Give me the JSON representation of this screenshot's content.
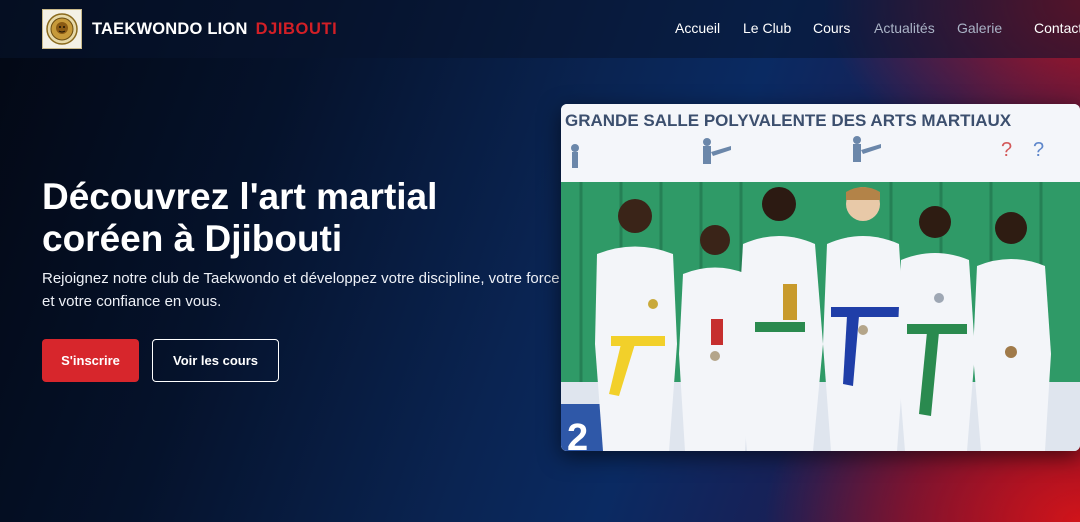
{
  "brand": {
    "name": "TAEKWONDO LION",
    "accent": "DJIBOUTI",
    "logo_icon": "lion-emblem-icon"
  },
  "nav": {
    "items": [
      {
        "label": "Accueil",
        "state": "active"
      },
      {
        "label": "Le Club",
        "state": "active"
      },
      {
        "label": "Cours",
        "state": "active"
      },
      {
        "label": "Actualités",
        "state": "dim"
      },
      {
        "label": "Galerie",
        "state": "dim"
      },
      {
        "label": "Contact",
        "state": "active"
      }
    ]
  },
  "hero": {
    "title_line1": "Découvrez l'art martial",
    "title_line2": "coréen à Djibouti",
    "subtitle_line1": "Rejoignez notre club de Taekwondo et développez votre discipline, votre force",
    "subtitle_line2": "et votre confiance en vous.",
    "primary_button": "S'inscrire",
    "secondary_button": "Voir les cours"
  },
  "photo": {
    "banner_text": "GRANDE SALLE POLYVALENTE DES ARTS MARTIAUX",
    "subject": "group-photo-children-taekwondo"
  },
  "colors": {
    "accent": "#d7262c",
    "background_dark": "#05122b",
    "background_blue": "#0a2a62"
  }
}
